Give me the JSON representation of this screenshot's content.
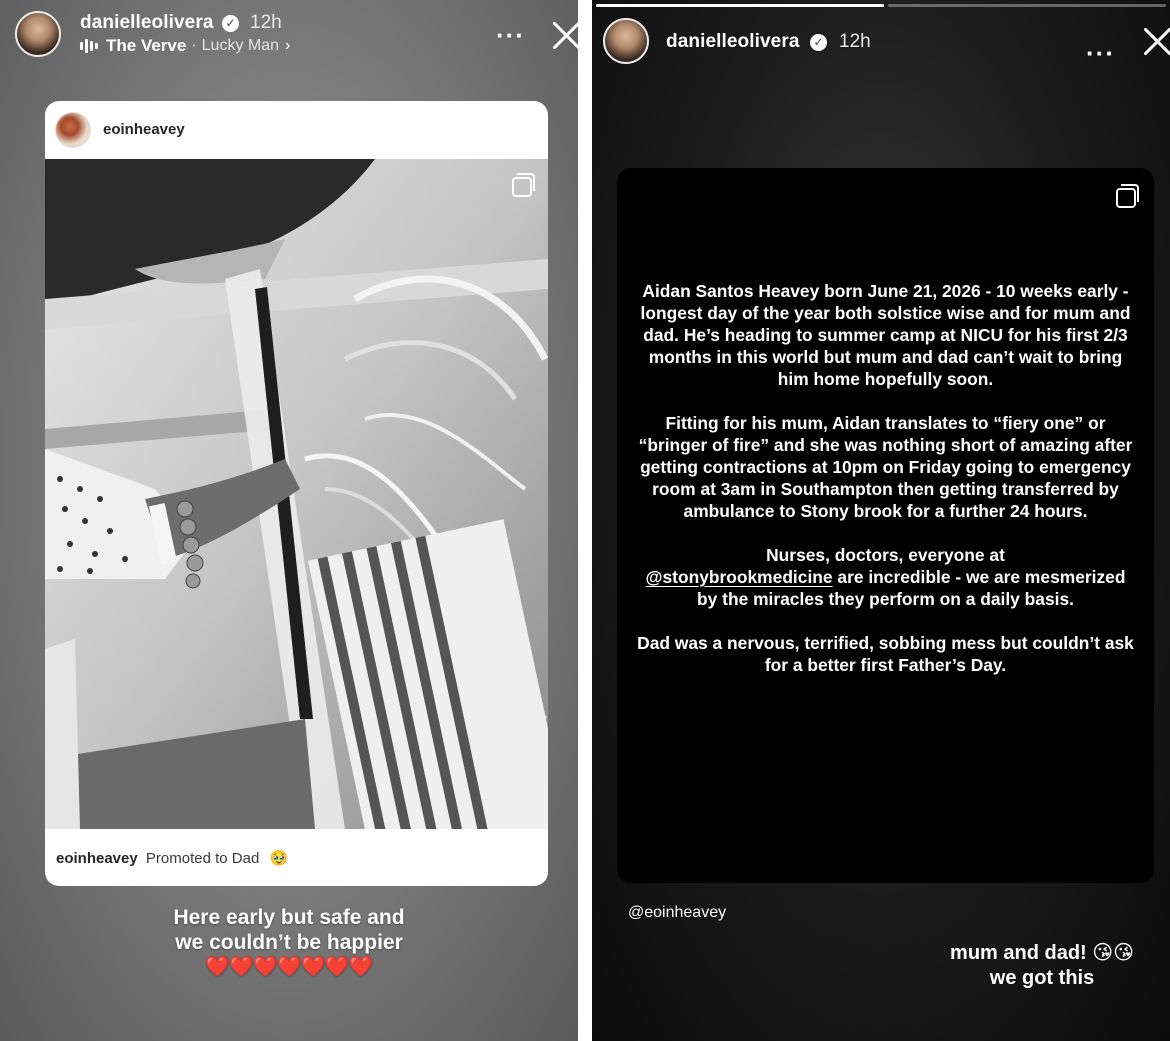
{
  "left_story": {
    "header": {
      "username": "danielleolivera",
      "verified_icon": "verified-badge-icon",
      "time": "12h",
      "more_icon": "ellipsis-icon",
      "close_icon": "close-icon"
    },
    "music": {
      "icon": "music-bars-icon",
      "artist": "The Verve",
      "separator": "·",
      "song": "Lucky Man",
      "chevron": "›"
    },
    "shared_post": {
      "username": "eoinheavey",
      "multi_photo_icon": "multiple-photos-icon",
      "caption_user": "eoinheavey",
      "caption_text": "Promoted to Dad",
      "caption_emoji": "🥹"
    },
    "caption": {
      "line1": "Here early but safe and",
      "line2": "we couldn’t be happier",
      "hearts": "❤️❤️❤️❤️❤️❤️❤️"
    }
  },
  "right_story": {
    "header": {
      "username": "danielleolivera",
      "verified_icon": "verified-badge-icon",
      "time": "12h",
      "more_icon": "ellipsis-icon",
      "close_icon": "close-icon"
    },
    "progress": [
      1,
      0
    ],
    "text_post": {
      "multi_photo_icon": "multiple-photos-icon",
      "para1": "Aidan Santos Heavey born June 21, 2026 - 10 weeks early - longest day of the year both solstice wise and for mum and dad. He’s heading to summer camp at NICU for his first 2/3 months in this world but mum and dad can’t wait to bring him home hopefully soon.",
      "para2": "Fitting for his mum, Aidan translates to “fiery one” or “bringer of fire” and she was nothing short of amazing after getting contractions at 10pm on Friday going to emergency room at 3am in Southampton then getting transferred by ambulance to Stony brook for a further 24 hours.",
      "para3_before": "Nurses, doctors, everyone at",
      "para3_link": "@stonybrookmedicine",
      "para3_after": " are incredible - we are mesmerized by the miracles they perform on a daily basis.",
      "para4": "Dad was a nervous, terrified, sobbing mess but couldn’t ask for a better first Father’s Day."
    },
    "mention": "@eoinheavey",
    "caption": {
      "line1": "mum and dad! 😘😘",
      "line2": "we got this"
    }
  }
}
